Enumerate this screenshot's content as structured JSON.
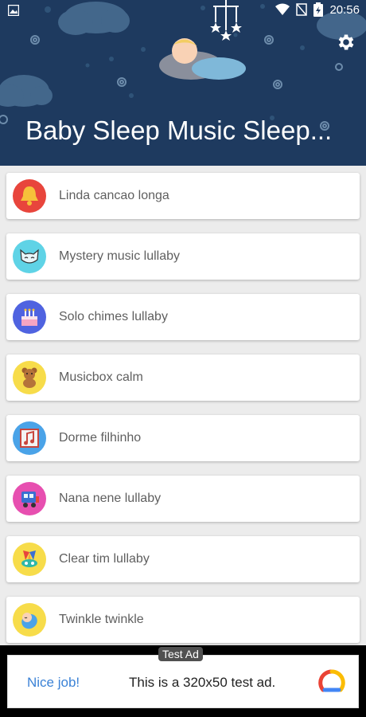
{
  "status_bar": {
    "time": "20:56"
  },
  "header": {
    "title": "Baby Sleep Music Sleep..."
  },
  "items": [
    {
      "label": "Linda cancao longa",
      "icon": "bell-icon",
      "color": "#e8453c"
    },
    {
      "label": "Mystery music lullaby",
      "icon": "cat-icon",
      "color": "#5fd3e6"
    },
    {
      "label": "Solo chimes lullaby",
      "icon": "cake-icon",
      "color": "#4f63e0"
    },
    {
      "label": "Musicbox calm",
      "icon": "teddy-bear-icon",
      "color": "#f7dc4a"
    },
    {
      "label": "Dorme filhinho",
      "icon": "music-note-icon",
      "color": "#4aa3e8"
    },
    {
      "label": "Nana nene lullaby",
      "icon": "train-icon",
      "color": "#e74fb0"
    },
    {
      "label": "Clear tim lullaby",
      "icon": "jester-hat-icon",
      "color": "#f7dc4a"
    },
    {
      "label": "Twinkle twinkle",
      "icon": "sleeping-baby-icon",
      "color": "#f7dc4a"
    }
  ],
  "ad": {
    "tag": "Test Ad",
    "cta": "Nice job!",
    "text": "This is a 320x50 test ad."
  }
}
